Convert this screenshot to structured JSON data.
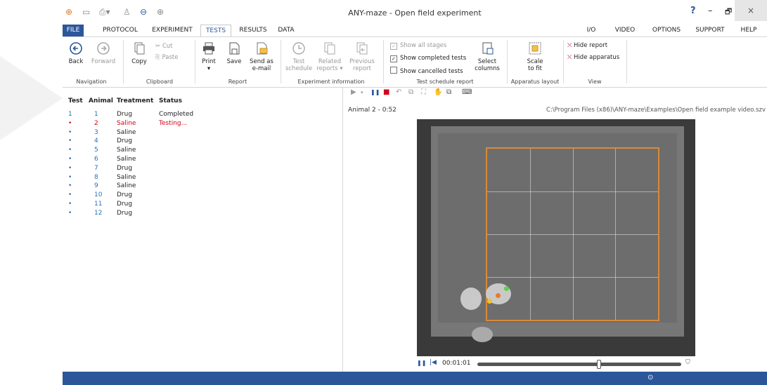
{
  "window": {
    "title": "ANY-maze - Open field experiment",
    "help_glyph": "?",
    "minimize_glyph": "–",
    "restore_glyph": "🗗",
    "close_glyph": "×"
  },
  "menu": [
    "FILE",
    "PROTOCOL",
    "EXPERIMENT",
    "TESTS",
    "RESULTS",
    "DATA",
    "I/O",
    "VIDEO",
    "OPTIONS",
    "SUPPORT",
    "HELP"
  ],
  "ribbon": {
    "back": "Back",
    "forward": "Forward",
    "copy": "Copy",
    "cut": "Cut",
    "paste": "Paste",
    "print": "Print",
    "print_arrow": "▾",
    "save": "Save",
    "send_email_1": "Send as",
    "send_email_2": "e-mail",
    "test_schedule_1": "Test",
    "test_schedule_2": "schedule",
    "related_reports_1": "Related",
    "related_reports_2": "reports ▾",
    "previous_report_1": "Previous",
    "previous_report_2": "report",
    "show_all_stages": "Show all stages",
    "show_completed_tests": "Show completed tests",
    "show_cancelled_tests": "Show cancelled tests",
    "check_mark": "✓",
    "select_columns_1": "Select",
    "select_columns_2": "columns",
    "scale_to_fit_1": "Scale",
    "scale_to_fit_2": "to fit",
    "hide_report": "Hide report",
    "hide_apparatus": "Hide apparatus",
    "groups": {
      "navigation": "Navigation",
      "clipboard": "Clipboard",
      "report": "Report",
      "experiment_information": "Experiment information",
      "test_schedule_report": "Test schedule report",
      "apparatus_layout": "Apparatus layout",
      "view": "View"
    }
  },
  "table": {
    "headers": [
      "Test",
      "Animal",
      "Treatment",
      "Status"
    ],
    "rows": [
      {
        "test": "1",
        "animal": "1",
        "treatment": "Drug",
        "status": "Completed"
      },
      {
        "test": "•",
        "animal": "2",
        "treatment": "Saline",
        "status": "Testing..."
      },
      {
        "test": "•",
        "animal": "3",
        "treatment": "Saline",
        "status": ""
      },
      {
        "test": "•",
        "animal": "4",
        "treatment": "Drug",
        "status": ""
      },
      {
        "test": "•",
        "animal": "5",
        "treatment": "Saline",
        "status": ""
      },
      {
        "test": "•",
        "animal": "6",
        "treatment": "Saline",
        "status": ""
      },
      {
        "test": "•",
        "animal": "7",
        "treatment": "Drug",
        "status": ""
      },
      {
        "test": "•",
        "animal": "8",
        "treatment": "Saline",
        "status": ""
      },
      {
        "test": "•",
        "animal": "9",
        "treatment": "Saline",
        "status": ""
      },
      {
        "test": "•",
        "animal": "10",
        "treatment": "Drug",
        "status": ""
      },
      {
        "test": "•",
        "animal": "11",
        "treatment": "Drug",
        "status": ""
      },
      {
        "test": "•",
        "animal": "12",
        "treatment": "Drug",
        "status": ""
      }
    ]
  },
  "video": {
    "label": "Animal 2 - 0:52",
    "path": "C:\\Program Files (x86)\\ANY-maze\\Examples\\Open field example video.szv",
    "time": "00:01:01",
    "pause_glyph": "❚❚",
    "rewind_glyph": "|◀"
  },
  "colors": {
    "accent": "#2b579a",
    "testing_red": "#d0021b",
    "zone_orange": "#d98a3a"
  }
}
